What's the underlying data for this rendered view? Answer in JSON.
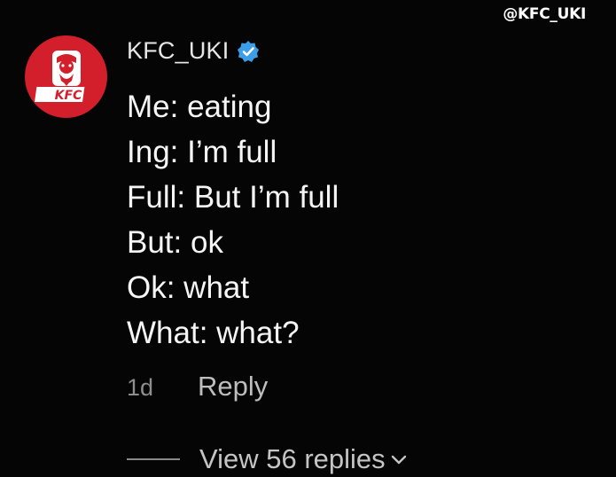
{
  "watermark": "@KFC_UKI",
  "comment": {
    "username": "KFC_UKI",
    "verified": true,
    "avatar": {
      "logo_text": "KFC",
      "background_color": "#d21f2b"
    },
    "lines": [
      "Me: eating",
      "Ing: I’m full",
      "Full: But I’m full",
      "But: ok",
      "Ok: what",
      "What: what?"
    ],
    "time_ago": "1d",
    "reply_label": "Reply",
    "view_replies_label": "View 56 replies"
  },
  "colors": {
    "background": "#050505",
    "verified_badge": "#3d9ee8",
    "brand_red": "#d21f2b"
  }
}
